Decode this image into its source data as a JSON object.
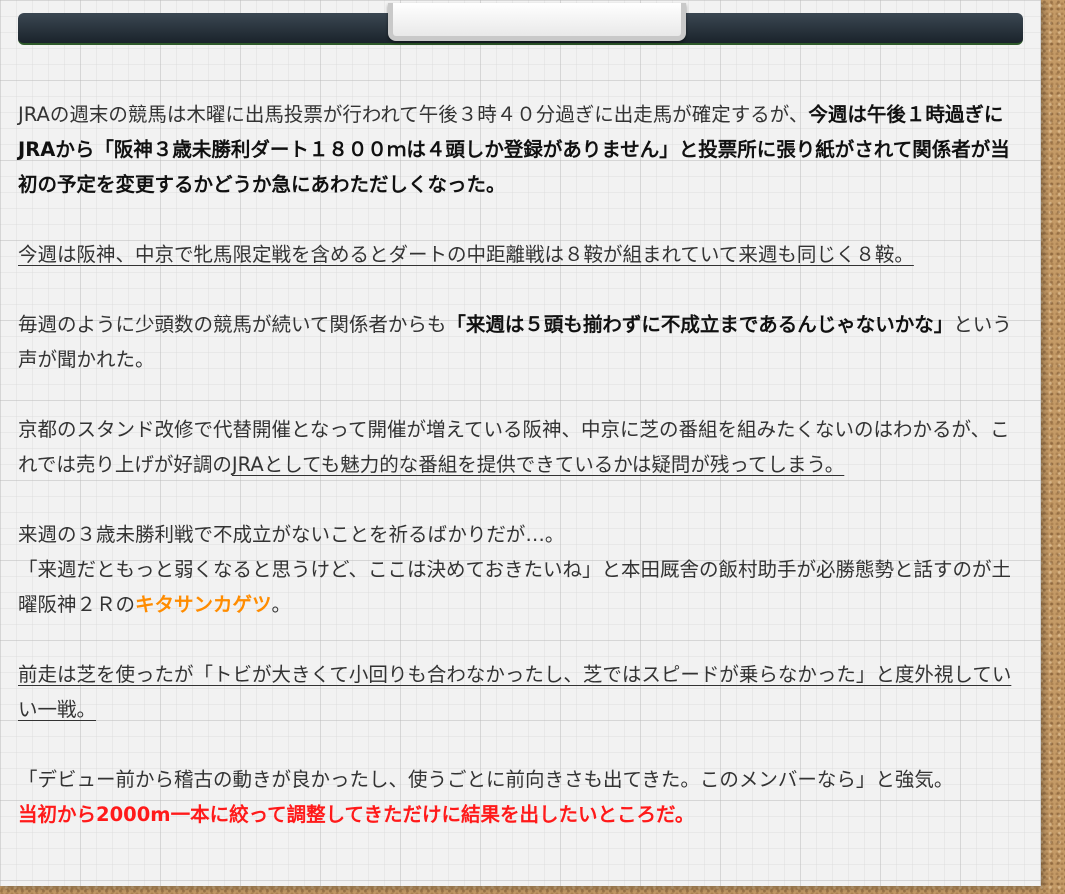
{
  "article": {
    "p1": {
      "a": "JRAの週末の競馬は木曜に出馬投票が行われて午後３時４０分過ぎに出走馬が確定するが、",
      "b": "今週は午後１時過ぎにJRAから「阪神３歳未勝利ダート１８００ｍは４頭しか登録がありません」と投票所に張り紙がされて関係者が当初の予定を変更するかどうか急にあわただしくなった。"
    },
    "p2": "今週は阪神、中京で牝馬限定戦を含めるとダートの中距離戦は８鞍が組まれていて来週も同じく８鞍。",
    "p3": {
      "a": "毎週のように少頭数の競馬が続いて関係者からも",
      "b": "「来週は５頭も揃わずに不成立まであるんじゃないかな」",
      "c": "という声が聞かれた。"
    },
    "p4": {
      "a": "京都のスタンド改修で代替開催となって開催が増えている阪神、中京に芝の番組を組みたくないのはわかるが、これでは売り上げが好調の",
      "b": "JRAとしても魅力的な番組を提供できているかは疑問が残ってしまう。"
    },
    "p5": {
      "line1": "来週の３歳未勝利戦で不成立がないことを祈るばかりだが…。",
      "line2a": "「来週だともっと弱くなると思うけど、ここは決めておきたいね」と本田厩舎の飯村助手が必勝態勢と話すのが土曜阪神２Ｒの",
      "horse": "キタサンカゲツ",
      "line2b": "。"
    },
    "p6": "前走は芝を使ったが「トビが大きくて小回りも合わなかったし、芝ではスピードが乗らなかった」と度外視していい一戦。",
    "p7": {
      "line1": "「デビュー前から稽古の動きが良かったし、使うごとに前向きさも出てきた。このメンバーなら」と強気。",
      "line2": "当初から2000m一本に絞って調整してきただけに結果を出したいところだ。"
    }
  },
  "colors": {
    "highlight_orange": "#ff8c00",
    "highlight_red": "#ff1a1a",
    "header_bar": "#1a232b"
  }
}
